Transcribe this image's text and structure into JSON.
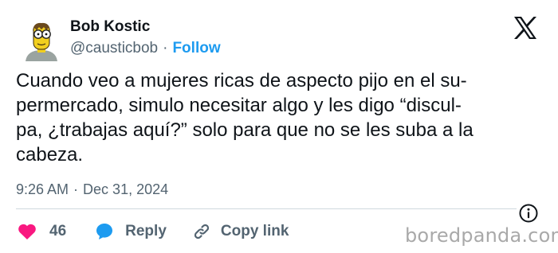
{
  "author": {
    "name": "Bob Kostic",
    "handle": "@causticbob",
    "separator": "·",
    "follow_label": "Follow"
  },
  "tweet": {
    "text_lines": [
      "Cuando veo a mujeres ricas de aspecto pijo en el su-",
      "permercado, simulo necesitar algo y les digo “discul-",
      "pa, ¿trabajas aquí?” solo para que no se les suba a la",
      "cabeza."
    ],
    "time": "9:26 AM",
    "separator": "·",
    "date": "Dec 31, 2024"
  },
  "actions": {
    "like_count": "46",
    "reply_label": "Reply",
    "copy_link_label": "Copy link"
  },
  "watermark": "boredpanda.com",
  "colors": {
    "accent": "#1d9bf0",
    "text": "#0f1419",
    "muted": "#536471",
    "like": "#f91880",
    "reply": "#1d9bf0",
    "watermark": "#a9a9a9"
  },
  "icons": {
    "avatar": "simpsons-style-avatar",
    "brand": "x-logo-icon",
    "like": "heart-icon",
    "reply": "speech-bubble-icon",
    "copy_link": "link-icon",
    "info": "info-icon"
  }
}
